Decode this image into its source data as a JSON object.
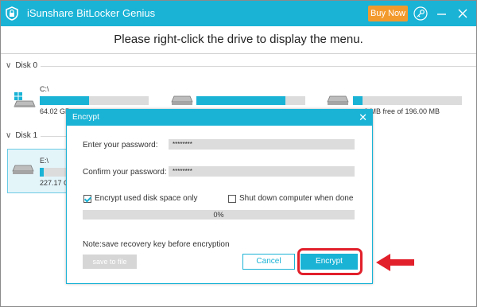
{
  "app": {
    "title": "iSunshare BitLocker Genius",
    "buy_label": "Buy Now",
    "headline": "Please right-click the drive to display the menu.",
    "colors": {
      "accent": "#1ab3d6",
      "buy": "#f39a2d",
      "highlight": "#e1202b"
    }
  },
  "disks": [
    {
      "label": "Disk 0",
      "drives": [
        {
          "name": "C:\\",
          "size_text": "64.02 GB",
          "used_fraction": 0.45,
          "icon": "windows-drive-icon"
        },
        {
          "name": "",
          "size_text": "",
          "used_fraction": 0.82,
          "icon": "drive-icon"
        },
        {
          "name": "",
          "size_text": "0 MB free of 196.00 MB",
          "used_fraction": 0.09,
          "icon": "drive-icon"
        }
      ]
    },
    {
      "label": "Disk 1",
      "drives": [
        {
          "name": "E:\\",
          "size_text": "227.17 G",
          "used_fraction": 0.15,
          "icon": "drive-icon"
        }
      ]
    }
  ],
  "dialog": {
    "title": "Encrypt",
    "password_label": "Enter your password:",
    "password_value": "********",
    "confirm_label": "Confirm your password:",
    "confirm_value": "********",
    "option_used_space": {
      "label": "Encrypt used disk space only",
      "checked": true
    },
    "option_shutdown": {
      "label": "Shut down computer when done",
      "checked": false
    },
    "progress_text": "0%",
    "note": "Note:save recovery key before encryption",
    "save_label": "save to file",
    "cancel_label": "Cancel",
    "encrypt_label": "Encrypt"
  }
}
